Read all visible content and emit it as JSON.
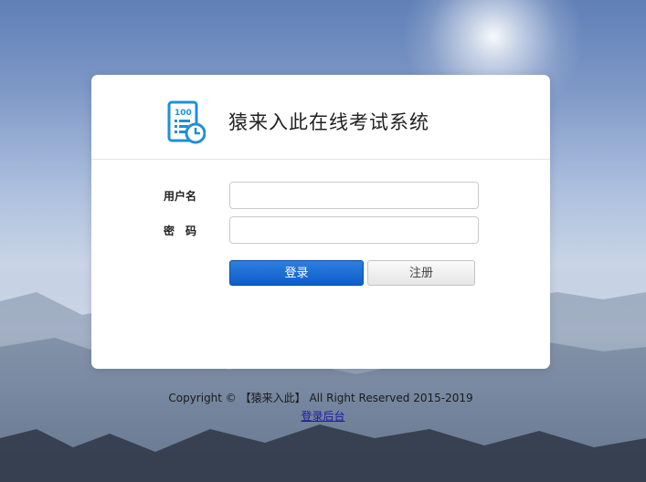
{
  "header": {
    "title": "猿来入此在线考试系统",
    "logo_icon": "exam-paper-icon",
    "logo_text": "100"
  },
  "form": {
    "username_label": "用户名",
    "password_label": "密码",
    "username_value": "",
    "password_value": "",
    "login_label": "登录",
    "register_label": "注册"
  },
  "footer": {
    "copyright": "Copyright © 【猿来入此】 All Right Reserved 2015-2019",
    "admin_link": "登录后台"
  },
  "colors": {
    "primary_button": "#0d5ec8",
    "logo_blue": "#1f8fd8"
  }
}
